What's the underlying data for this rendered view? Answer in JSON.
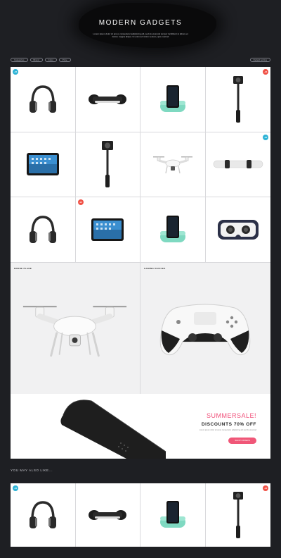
{
  "hero": {
    "title": "MODERN GADGETS",
    "subtitle": "Lorem ipsum dolor sit amet, consectetur adipisicing elit, sed do eiusmod tempor incididunt ut labore et dolore magna aliqua. Ut enim ad minim veniam, quis nostrud"
  },
  "filters": [
    "Categories",
    "Brand",
    "Color",
    "Price"
  ],
  "sort_label": "Default sorting",
  "badges": {
    "r1c1": "-15",
    "r1c4": "-12",
    "r2c4": "-10",
    "r3c2": "-12",
    "b1": "-10",
    "b4": "-12"
  },
  "features": {
    "left_label": "DRONE PLANE",
    "right_label": "GAMING DEVICES"
  },
  "sale": {
    "headline": "SUMMERSALE!",
    "discount": "DISCOUNTS 70% OFF",
    "note": "Lorem ipsum dolor sit amet consectetur adipisicing elit sed do eiusmod",
    "button": "SHOP OFFERS"
  },
  "also_title": "YOU MAY ALSO LIKE...",
  "colors": {
    "background": "#1e1f23",
    "badge_blue": "#2cb3d6",
    "badge_red": "#f05045",
    "accent_pink": "#f05778"
  }
}
